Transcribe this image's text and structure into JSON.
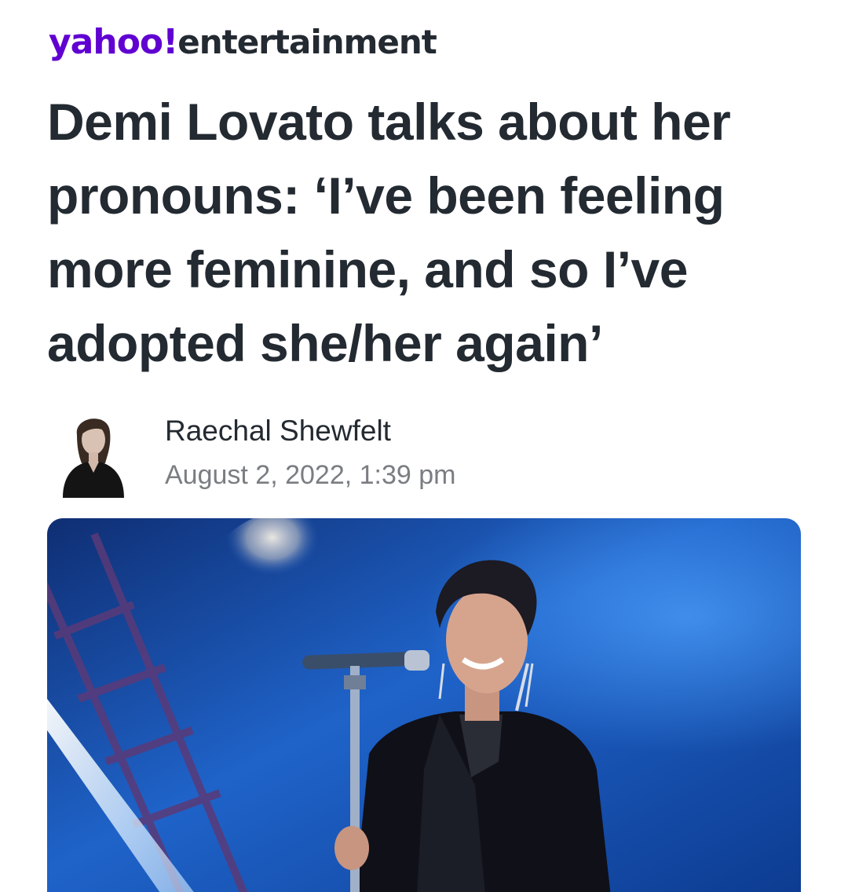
{
  "header": {
    "brand": "yahoo!",
    "section": "entertainment"
  },
  "article": {
    "title": "Demi Lovato talks about her pronouns: ‘I’ve been feeling more feminine, and so I’ve adopted she/her again’",
    "author": "Raechal Shewfelt",
    "date": "August 2, 2022, 1:39 pm"
  },
  "colors": {
    "brand": "#6001d2",
    "text": "#232a31",
    "meta": "#7a7d82"
  },
  "icons": {
    "avatar": "author-avatar",
    "hero": "article-hero-image"
  }
}
